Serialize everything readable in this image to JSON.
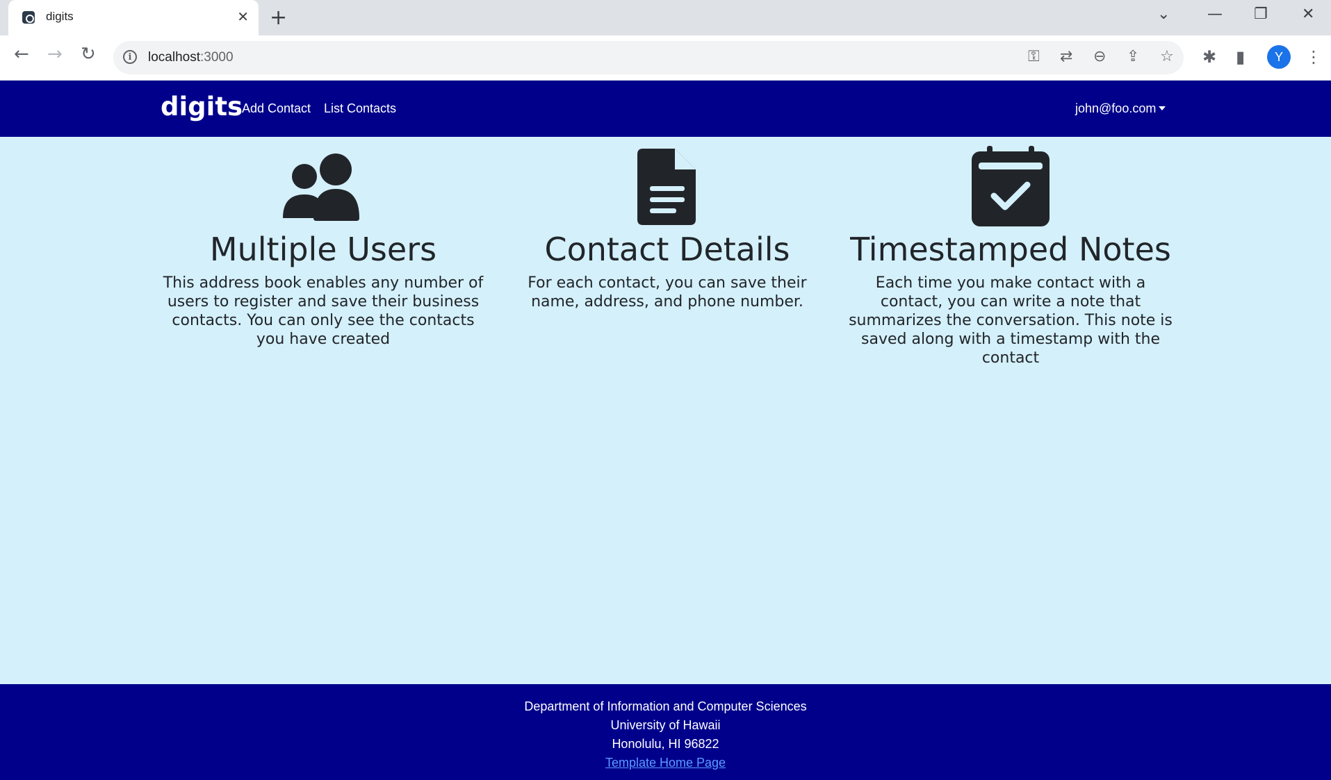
{
  "browser": {
    "tab_title": "digits",
    "url_host": "localhost",
    "url_port": ":3000",
    "profile_initial": "Y"
  },
  "navbar": {
    "brand": "digits",
    "links": [
      "Add Contact",
      "List Contacts"
    ],
    "user": "john@foo.com"
  },
  "features": [
    {
      "icon": "users-icon",
      "title": "Multiple Users",
      "text": "This address book enables any number of users to register and save their business contacts. You can only see the contacts you have created"
    },
    {
      "icon": "document-icon",
      "title": "Contact Details",
      "text": "For each contact, you can save their name, address, and phone number."
    },
    {
      "icon": "calendar-check-icon",
      "title": "Timestamped Notes",
      "text": "Each time you make contact with a contact, you can write a note that summarizes the conversation. This note is saved along with a timestamp with the contact"
    }
  ],
  "footer": {
    "line1": "Department of Information and Computer Sciences",
    "line2": "University of Hawaii",
    "line3": "Honolulu, HI 96822",
    "link": "Template Home Page"
  },
  "colors": {
    "navbar": "#00008b",
    "page_bg": "#d4f0fb",
    "text": "#212529"
  }
}
